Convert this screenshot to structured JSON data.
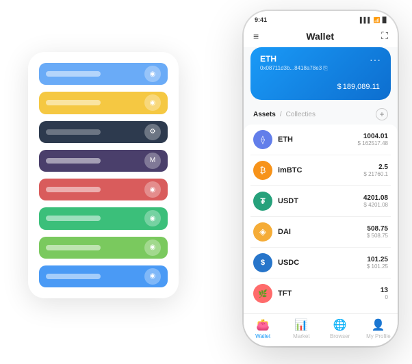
{
  "bg_panel": {
    "cards": [
      {
        "color": "#6aabf7",
        "line_color": "rgba(255,255,255,0.5)",
        "icon": "●"
      },
      {
        "color": "#f5c842",
        "line_color": "rgba(255,255,255,0.5)",
        "icon": "●"
      },
      {
        "color": "#2d3a4e",
        "line_color": "rgba(255,255,255,0.4)",
        "icon": "⚙"
      },
      {
        "color": "#4a3f6b",
        "line_color": "rgba(255,255,255,0.4)",
        "icon": "M"
      },
      {
        "color": "#d95c5c",
        "line_color": "rgba(255,255,255,0.5)",
        "icon": "●"
      },
      {
        "color": "#3bbf7a",
        "line_color": "rgba(255,255,255,0.5)",
        "icon": "●"
      },
      {
        "color": "#7ac95e",
        "line_color": "rgba(255,255,255,0.5)",
        "icon": "●"
      },
      {
        "color": "#4a9af5",
        "line_color": "rgba(255,255,255,0.5)",
        "icon": "●"
      }
    ]
  },
  "phone": {
    "status_bar": {
      "time": "9:41",
      "signal": "▌▌▌",
      "wifi": "WiFi",
      "battery": "🔋"
    },
    "header": {
      "menu_icon": "≡",
      "title": "Wallet",
      "expand_icon": "⛶"
    },
    "eth_card": {
      "name": "ETH",
      "address": "0x08711d3b...8418a78e3 ⎘",
      "balance_symbol": "$",
      "balance": "189,089.11",
      "dots": "···"
    },
    "assets_header": {
      "tab_active": "Assets",
      "divider": "/",
      "tab_inactive": "Collecties",
      "add_icon": "+"
    },
    "assets": [
      {
        "symbol": "ETH",
        "icon_bg": "#627EEA",
        "icon_text": "⟠",
        "amount": "1004.01",
        "value": "$ 162517.48"
      },
      {
        "symbol": "imBTC",
        "icon_bg": "#F7931A",
        "icon_text": "₿",
        "amount": "2.5",
        "value": "$ 21760.1"
      },
      {
        "symbol": "USDT",
        "icon_bg": "#26A17B",
        "icon_text": "₮",
        "amount": "4201.08",
        "value": "$ 4201.08"
      },
      {
        "symbol": "DAI",
        "icon_bg": "#F5AC37",
        "icon_text": "◈",
        "amount": "508.75",
        "value": "$ 508.75"
      },
      {
        "symbol": "USDC",
        "icon_bg": "#2775CA",
        "icon_text": "$",
        "amount": "101.25",
        "value": "$ 101.25"
      },
      {
        "symbol": "TFT",
        "icon_bg": "#ff6b6b",
        "icon_text": "🌿",
        "amount": "13",
        "value": "0"
      }
    ],
    "nav": [
      {
        "icon": "👛",
        "label": "Wallet",
        "active": true
      },
      {
        "icon": "📈",
        "label": "Market",
        "active": false
      },
      {
        "icon": "🌐",
        "label": "Browser",
        "active": false
      },
      {
        "icon": "👤",
        "label": "My Profile",
        "active": false
      }
    ]
  }
}
